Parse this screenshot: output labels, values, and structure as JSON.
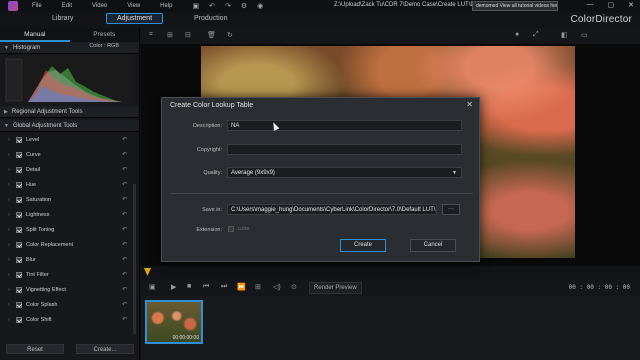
{
  "menubar": {
    "items": [
      "File",
      "Edit",
      "Video",
      "View",
      "Help"
    ],
    "path": "Z:\\Upload\\Zack Tu\\CDR 7\\Demo Case\\Create LUT\\Dem",
    "tooltip": "demomed View all tutorial videos here!"
  },
  "modes": {
    "library": "Library",
    "adjustment": "Adjustment",
    "production": "Production"
  },
  "brand": "ColorDirector",
  "left_panel": {
    "tabs": {
      "manual": "Manual",
      "presets": "Presets"
    },
    "histogram": {
      "title": "Histogram",
      "mode": "Color",
      "mode2": "RGB"
    },
    "regional": "Regional Adjustment Tools",
    "global": "Global Adjustment Tools",
    "tools": [
      "Level",
      "Curve",
      "Detail",
      "Hue",
      "Saturation",
      "Lightness",
      "Split Toning",
      "Color Replacement",
      "Blur",
      "Tint Filter",
      "Vignetting Effect",
      "Color Splash",
      "Color Shift"
    ],
    "reset_label": "Reset",
    "create_label": "Create..."
  },
  "timeline": {
    "render_label": "Render Preview",
    "timecode": "00 : 00 : 00 : 00",
    "clip_time": "00:00:00:00"
  },
  "dialog": {
    "title": "Create Color Lookup Table",
    "description_label": "Description:",
    "description_value": "NA",
    "copyright_label": "Copyright:",
    "copyright_value": "",
    "quality_label": "Quality:",
    "quality_value": "Average (9x9x9)",
    "save_label": "Save in:",
    "save_value": "C:\\Users\\maggie_hung\\Documents\\CyberLink\\ColorDirector\\7.0\\Default LUT\\",
    "browse_label": "···",
    "extension_label": "Extension:",
    "extension_value": ".cube",
    "create_label": "Create",
    "cancel_label": "Cancel"
  }
}
